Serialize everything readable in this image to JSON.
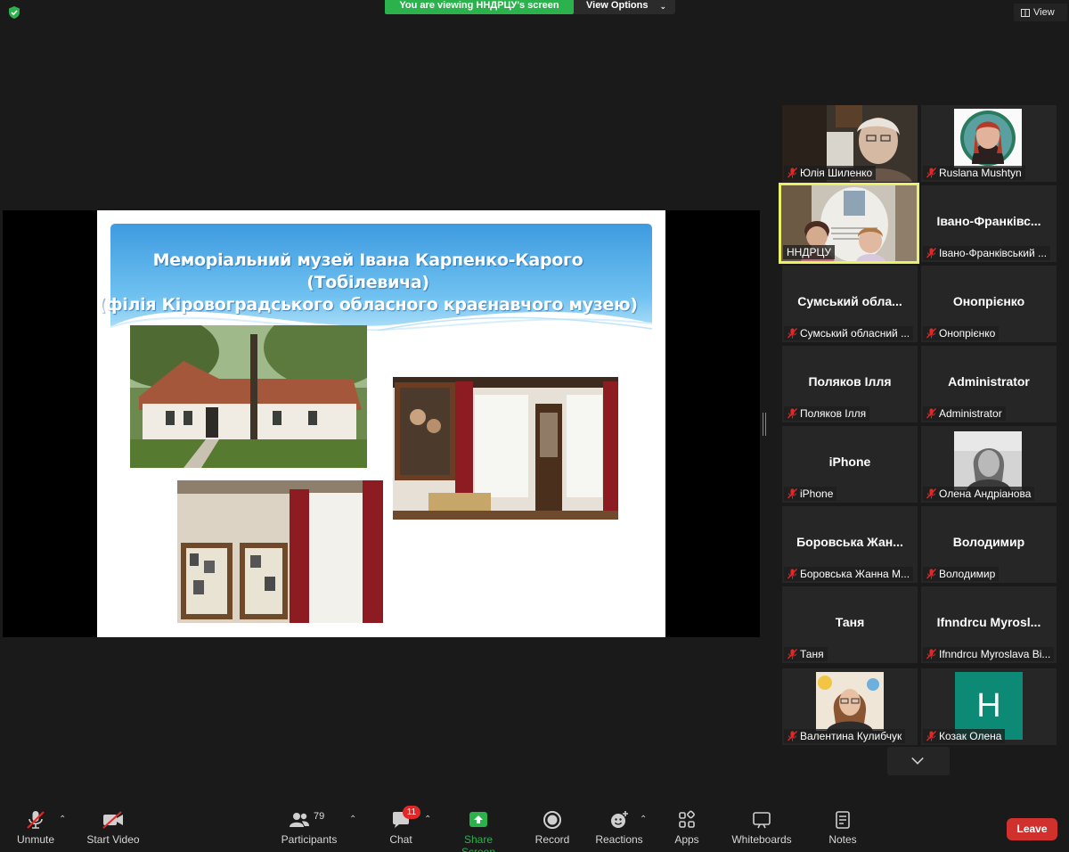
{
  "top_bar": {
    "viewing_banner": "You are viewing ННДРЦУ's screen",
    "view_options": "View Options",
    "view_button": "View"
  },
  "slide": {
    "title_line1": "Меморіальний музей Івана Карпенко-Карого (Тобілевича)",
    "title_line2": "(філія Кіровоградського обласного краєнавчого музею)"
  },
  "gallery": {
    "tiles": [
      {
        "label": "Юлія Шиленко",
        "big_name": ""
      },
      {
        "label": "Ruslana Mushtyn",
        "big_name": ""
      },
      {
        "label": "ННДРЦУ",
        "big_name": ""
      },
      {
        "label": "Івано-Франківський ...",
        "big_name": "Івано-Франківс..."
      },
      {
        "label": "Сумський обласний ...",
        "big_name": "Сумський обла..."
      },
      {
        "label": "Онопрієнко",
        "big_name": "Онопрієнко"
      },
      {
        "label": "Поляков Ілля",
        "big_name": "Поляков Ілля"
      },
      {
        "label": "Administrator",
        "big_name": "Administrator"
      },
      {
        "label": "iPhone",
        "big_name": "iPhone"
      },
      {
        "label": "Олена Андріанова",
        "big_name": ""
      },
      {
        "label": "Боровська Жанна М...",
        "big_name": "Боровська Жан..."
      },
      {
        "label": "Володимир",
        "big_name": "Володимир"
      },
      {
        "label": "Таня",
        "big_name": "Таня"
      },
      {
        "label": "Ifnndrcu Myroslava Bi...",
        "big_name": "Ifnndrcu Myrosl..."
      },
      {
        "label": "Валентина Кулибчук",
        "big_name": ""
      },
      {
        "label": "Козак Олена",
        "big_name": "",
        "letter": "H"
      }
    ]
  },
  "toolbar": {
    "unmute": "Unmute",
    "start_video": "Start Video",
    "participants": "Participants",
    "participants_count": "79",
    "chat": "Chat",
    "chat_badge": "11",
    "share_screen": "Share Screen",
    "record": "Record",
    "reactions": "Reactions",
    "apps": "Apps",
    "whiteboards": "Whiteboards",
    "notes": "Notes",
    "leave": "Leave"
  },
  "colors": {
    "share_green": "#2bb24c",
    "active_speaker": "#e9f06b",
    "leave_red": "#d0312d",
    "muted_red": "#e02828"
  }
}
